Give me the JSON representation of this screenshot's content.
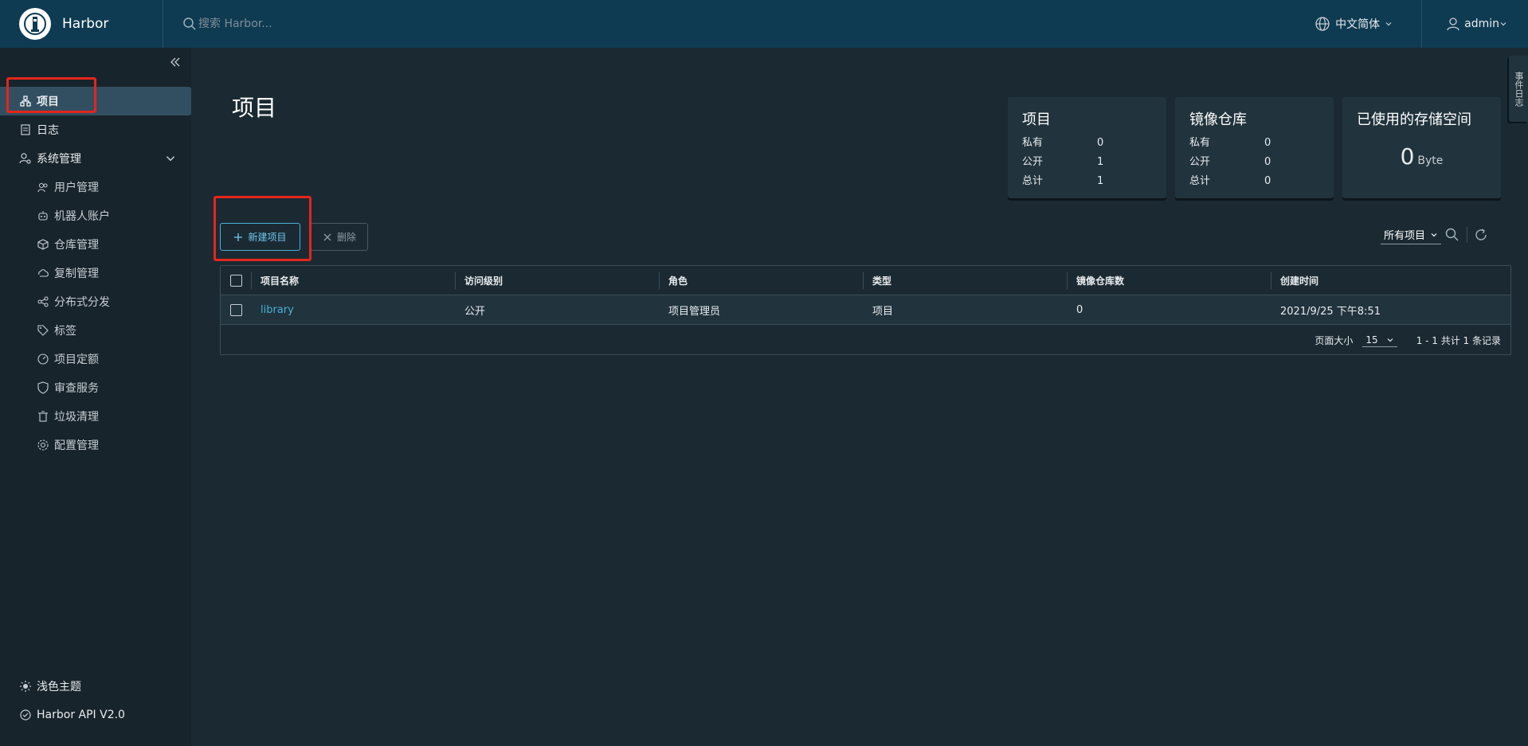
{
  "header": {
    "app_name": "Harbor",
    "search_placeholder": "搜索 Harbor...",
    "language": "中文简体",
    "user": "admin"
  },
  "sidebar": {
    "items": [
      {
        "label": "项目",
        "icon": "projects-icon"
      },
      {
        "label": "日志",
        "icon": "log-icon"
      },
      {
        "label": "系统管理",
        "icon": "admin-icon"
      }
    ],
    "sub_items": [
      {
        "label": "用户管理",
        "icon": "users-icon"
      },
      {
        "label": "机器人账户",
        "icon": "robot-icon"
      },
      {
        "label": "仓库管理",
        "icon": "registry-icon"
      },
      {
        "label": "复制管理",
        "icon": "replication-icon"
      },
      {
        "label": "分布式分发",
        "icon": "distribution-icon"
      },
      {
        "label": "标签",
        "icon": "tag-icon"
      },
      {
        "label": "项目定额",
        "icon": "quota-icon"
      },
      {
        "label": "审查服务",
        "icon": "shield-icon"
      },
      {
        "label": "垃圾清理",
        "icon": "trash-icon"
      },
      {
        "label": "配置管理",
        "icon": "gear-icon"
      }
    ],
    "bottom": {
      "theme": "浅色主题",
      "api": "Harbor API V2.0"
    }
  },
  "main": {
    "title": "项目",
    "cards": {
      "projects": {
        "title": "项目",
        "private_label": "私有",
        "private": "0",
        "public_label": "公开",
        "public": "1",
        "total_label": "总计",
        "total": "1"
      },
      "repos": {
        "title": "镜像仓库",
        "private_label": "私有",
        "private": "0",
        "public_label": "公开",
        "public": "0",
        "total_label": "总计",
        "total": "0"
      },
      "storage": {
        "title": "已使用的存储空间",
        "value": "0",
        "unit": "Byte"
      }
    },
    "actions": {
      "new_project": "新建项目",
      "delete": "删除"
    },
    "filter": {
      "selected": "所有项目"
    },
    "table": {
      "columns": [
        "项目名称",
        "访问级别",
        "角色",
        "类型",
        "镜像仓库数",
        "创建时间"
      ],
      "rows": [
        {
          "name": "library",
          "access": "公开",
          "role": "项目管理员",
          "type": "项目",
          "repo_count": "0",
          "created": "2021/9/25 下午8:51"
        }
      ],
      "footer": {
        "page_size_label": "页面大小",
        "page_size": "15",
        "summary": "1 - 1 共计 1 条记录"
      }
    },
    "side_tab": "事件日志"
  },
  "colors": {
    "accent": "#49afd9",
    "header_bg": "#0f3b52",
    "highlight": "#e5251c"
  }
}
